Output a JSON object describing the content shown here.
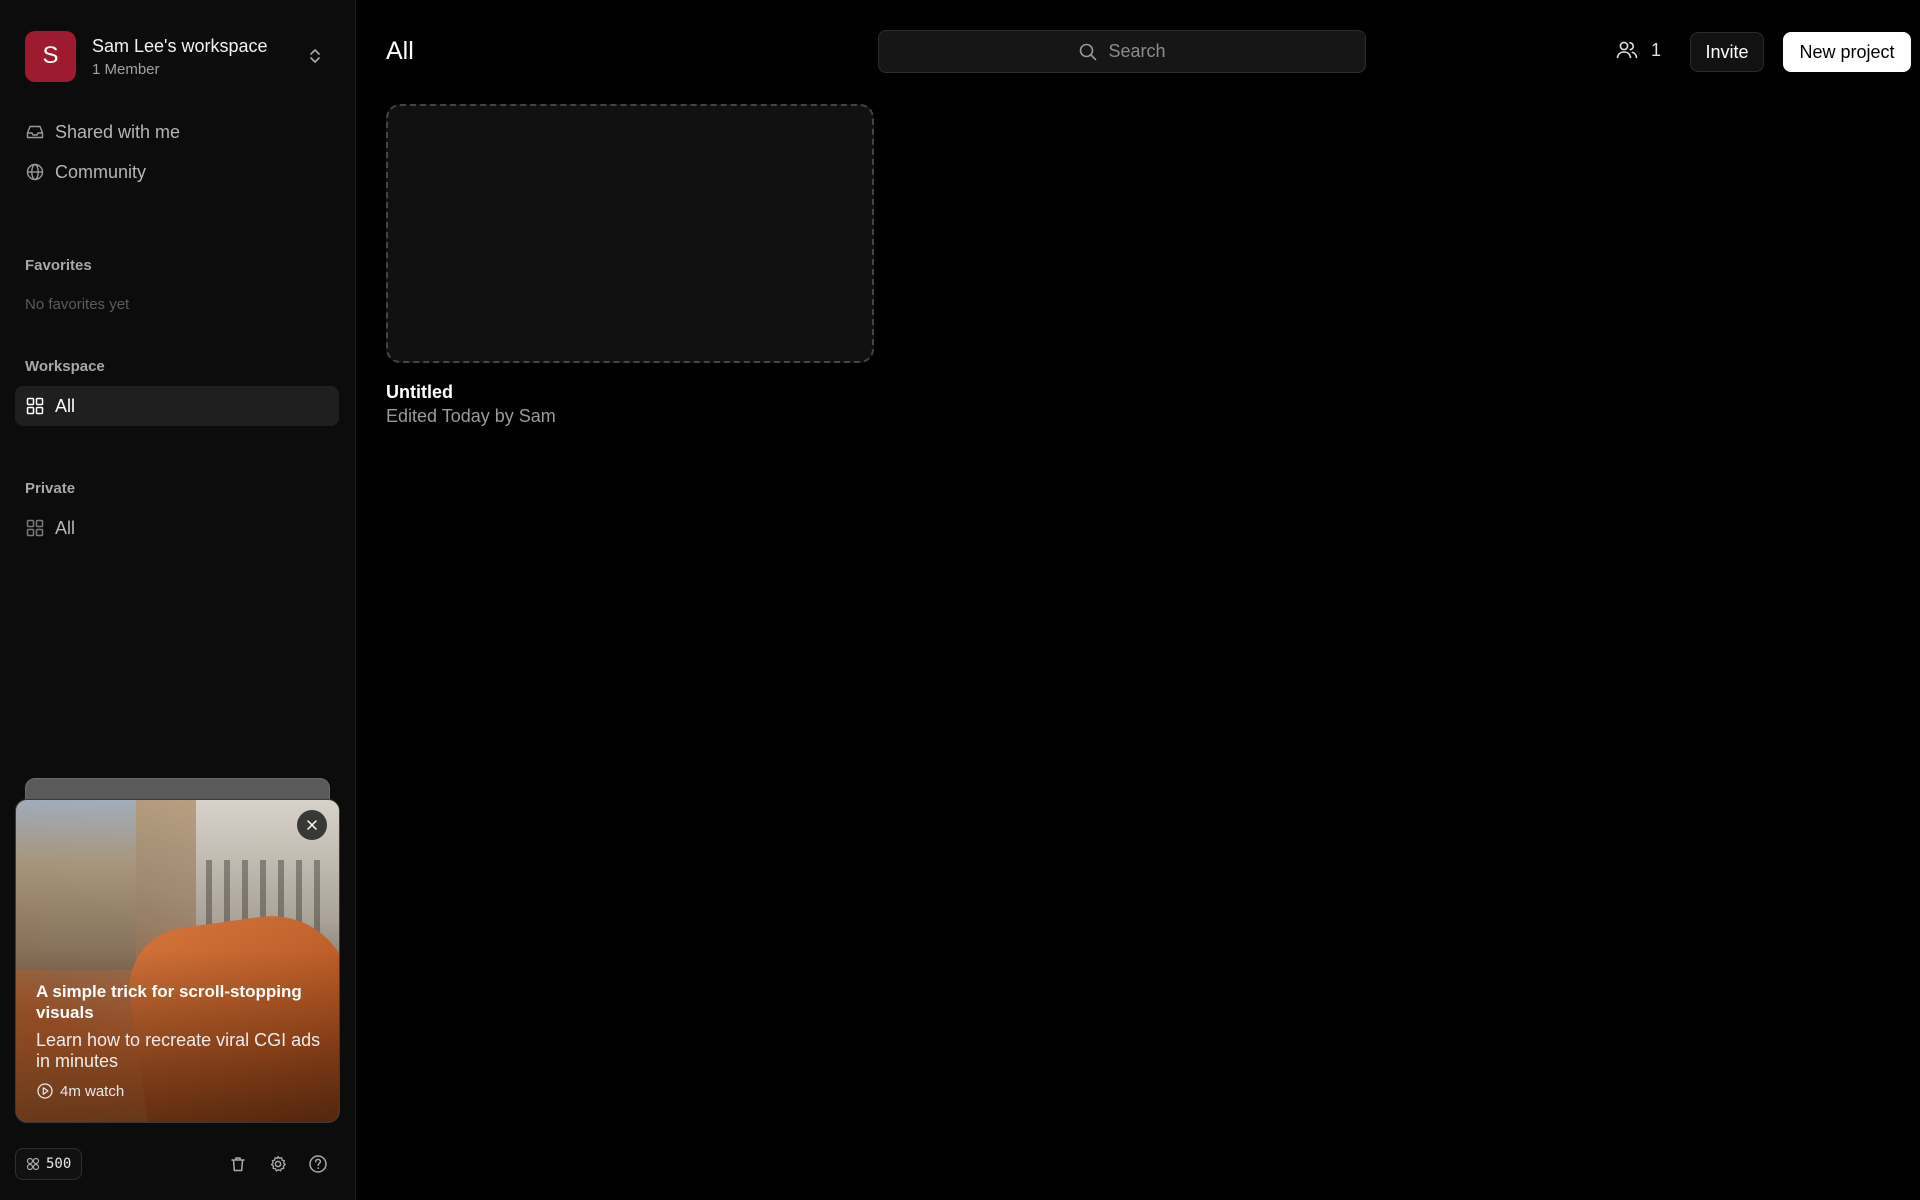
{
  "workspace": {
    "avatar_letter": "S",
    "name": "Sam Lee's workspace",
    "members": "1 Member",
    "avatar_color": "#9e1a2e"
  },
  "nav": {
    "shared": "Shared with me",
    "community": "Community"
  },
  "favorites": {
    "heading": "Favorites",
    "empty": "No favorites yet"
  },
  "workspace_section": {
    "heading": "Workspace",
    "all": "All"
  },
  "private_section": {
    "heading": "Private",
    "all": "All"
  },
  "promo": {
    "title": "A simple trick for scroll-stopping visuals",
    "subtitle": "Learn how to recreate viral CGI ads in minutes",
    "watch": "4m watch"
  },
  "bottom": {
    "credits": "500",
    "icons": [
      "trash-icon",
      "gear-icon",
      "help-icon"
    ]
  },
  "header": {
    "title": "All",
    "search_placeholder": "Search",
    "member_count": "1",
    "invite_label": "Invite",
    "new_project_label": "New project"
  },
  "projects": [
    {
      "name": "Untitled",
      "meta": "Edited Today by Sam"
    }
  ]
}
